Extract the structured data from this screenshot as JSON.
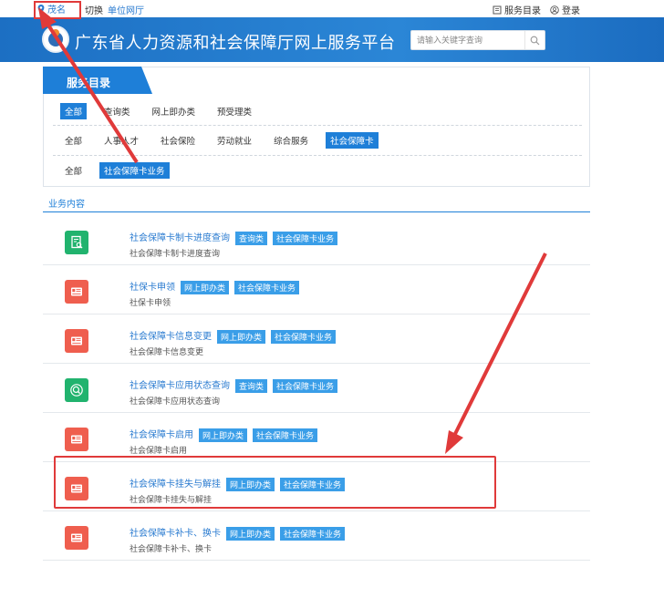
{
  "topbar": {
    "city": "茂名",
    "switch": "切换",
    "unit_hall": "单位网厅",
    "service_catalog": "服务目录",
    "login": "登录"
  },
  "header": {
    "title": "广东省人力资源和社会保障厅网上服务平台",
    "search_placeholder": "请输入关键字查询"
  },
  "panel": {
    "tab_label": "服务目录",
    "row1": [
      "全部",
      "查询类",
      "网上即办类",
      "预受理类"
    ],
    "row2": [
      "全部",
      "人事人才",
      "社会保险",
      "劳动就业",
      "综合服务",
      "社会保障卡"
    ],
    "row3": [
      "全部",
      "社会保障卡业务"
    ]
  },
  "section": {
    "title": "业务内容"
  },
  "items": [
    {
      "title": "社会保障卡制卡进度查询",
      "tags": [
        "查询类",
        "社会保障卡业务"
      ],
      "sub": "社会保障卡制卡进度查询",
      "icon": "document-search-icon",
      "color": "green"
    },
    {
      "title": "社保卡申领",
      "tags": [
        "网上即办类",
        "社会保障卡业务"
      ],
      "sub": "社保卡申领",
      "icon": "id-card-icon",
      "color": "red"
    },
    {
      "title": "社会保障卡信息变更",
      "tags": [
        "网上即办类",
        "社会保障卡业务"
      ],
      "sub": "社会保障卡信息变更",
      "icon": "id-card-icon",
      "color": "red"
    },
    {
      "title": "社会保障卡应用状态查询",
      "tags": [
        "查询类",
        "社会保障卡业务"
      ],
      "sub": "社会保障卡应用状态查询",
      "icon": "magnifier-icon",
      "color": "green"
    },
    {
      "title": "社会保障卡启用",
      "tags": [
        "网上即办类",
        "社会保障卡业务"
      ],
      "sub": "社会保障卡启用",
      "icon": "id-card-icon",
      "color": "red"
    },
    {
      "title": "社会保障卡挂失与解挂",
      "tags": [
        "网上即办类",
        "社会保障卡业务"
      ],
      "sub": "社会保障卡挂失与解挂",
      "icon": "id-card-icon",
      "color": "red"
    },
    {
      "title": "社会保障卡补卡、换卡",
      "tags": [
        "网上即办类",
        "社会保障卡业务"
      ],
      "sub": "社会保障卡补卡、换卡",
      "icon": "id-card-icon",
      "color": "red"
    }
  ],
  "colors": {
    "header_blue": "#1c6fc3",
    "accent_blue": "#1e7fd8",
    "tag_blue": "#3a9ee8",
    "icon_red": "#ef5e4e",
    "icon_green": "#21b36e",
    "annotation_red": "#e03a3a"
  }
}
